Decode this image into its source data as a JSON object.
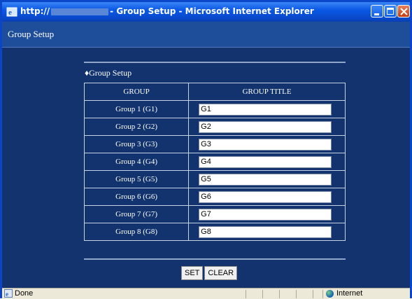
{
  "window": {
    "title_prefix": "http://",
    "title_suffix": "- Group Setup - Microsoft Internet Explorer"
  },
  "page": {
    "header": "Group Setup",
    "section_title": "♦Group Setup",
    "table": {
      "headers": [
        "GROUP",
        "GROUP TITLE"
      ],
      "rows": [
        {
          "label": "Group 1 (G1)",
          "value": "G1"
        },
        {
          "label": "Group 2 (G2)",
          "value": "G2"
        },
        {
          "label": "Group 3 (G3)",
          "value": "G3"
        },
        {
          "label": "Group 4 (G4)",
          "value": "G4"
        },
        {
          "label": "Group 5 (G5)",
          "value": "G5"
        },
        {
          "label": "Group 6 (G6)",
          "value": "G6"
        },
        {
          "label": "Group 7 (G7)",
          "value": "G7"
        },
        {
          "label": "Group 8 (G8)",
          "value": "G8"
        }
      ]
    },
    "buttons": {
      "set": "SET",
      "clear": "CLEAR"
    }
  },
  "statusbar": {
    "status": "Done",
    "zone": "Internet"
  },
  "colors": {
    "page_background": "#12336e",
    "titlebar": "#0a58e6"
  }
}
